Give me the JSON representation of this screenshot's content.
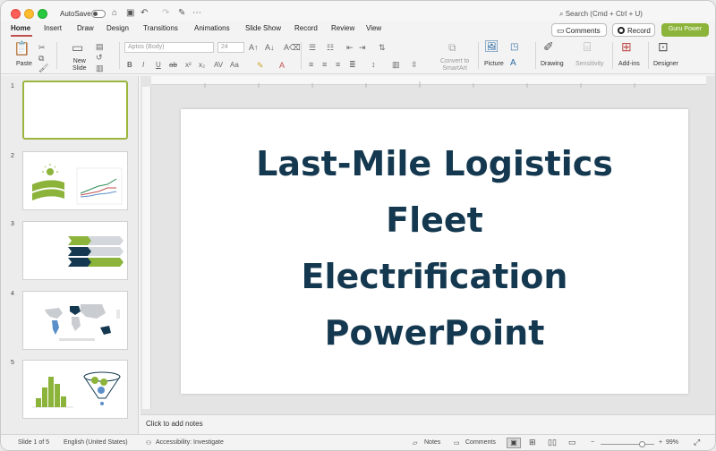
{
  "titlebar": {
    "autosave_label": "AutoSave",
    "search_placeholder": "Search (Cmd + Ctrl + U)"
  },
  "tabs": [
    "Home",
    "Insert",
    "Draw",
    "Design",
    "Transitions",
    "Animations",
    "Slide Show",
    "Record",
    "Review",
    "View"
  ],
  "actions": {
    "comments": "Comments",
    "record": "Record",
    "guru": "Guru Power"
  },
  "ribbon": {
    "paste": "Paste",
    "new_slide": "New\nSlide",
    "font_name": "Aptos (Body)",
    "font_size": "24",
    "convert": "Convert to\nSmartArt",
    "picture": "Picture",
    "drawing": "Drawing",
    "sensitivity": "Sensitivity",
    "addins": "Add-ins",
    "designer": "Designer"
  },
  "slides": [
    {
      "number": "1",
      "selected": true
    },
    {
      "number": "2",
      "selected": false
    },
    {
      "number": "3",
      "selected": false
    },
    {
      "number": "4",
      "selected": false
    },
    {
      "number": "5",
      "selected": false
    }
  ],
  "slide": {
    "title_lines": [
      "Last-Mile Logistics",
      "Fleet",
      "Electrification",
      "PowerPoint"
    ]
  },
  "notes_placeholder": "Click to add notes",
  "status": {
    "slide_count": "Slide 1 of 5",
    "language": "English (United States)",
    "accessibility": "Accessibility: Investigate",
    "notes": "Notes",
    "comments": "Comments",
    "zoom": "99%"
  },
  "colors": {
    "accent": "#8cb33a",
    "title": "#14384f",
    "close": "#ff5f57",
    "minimize": "#febc2e",
    "maximize": "#28c840"
  }
}
